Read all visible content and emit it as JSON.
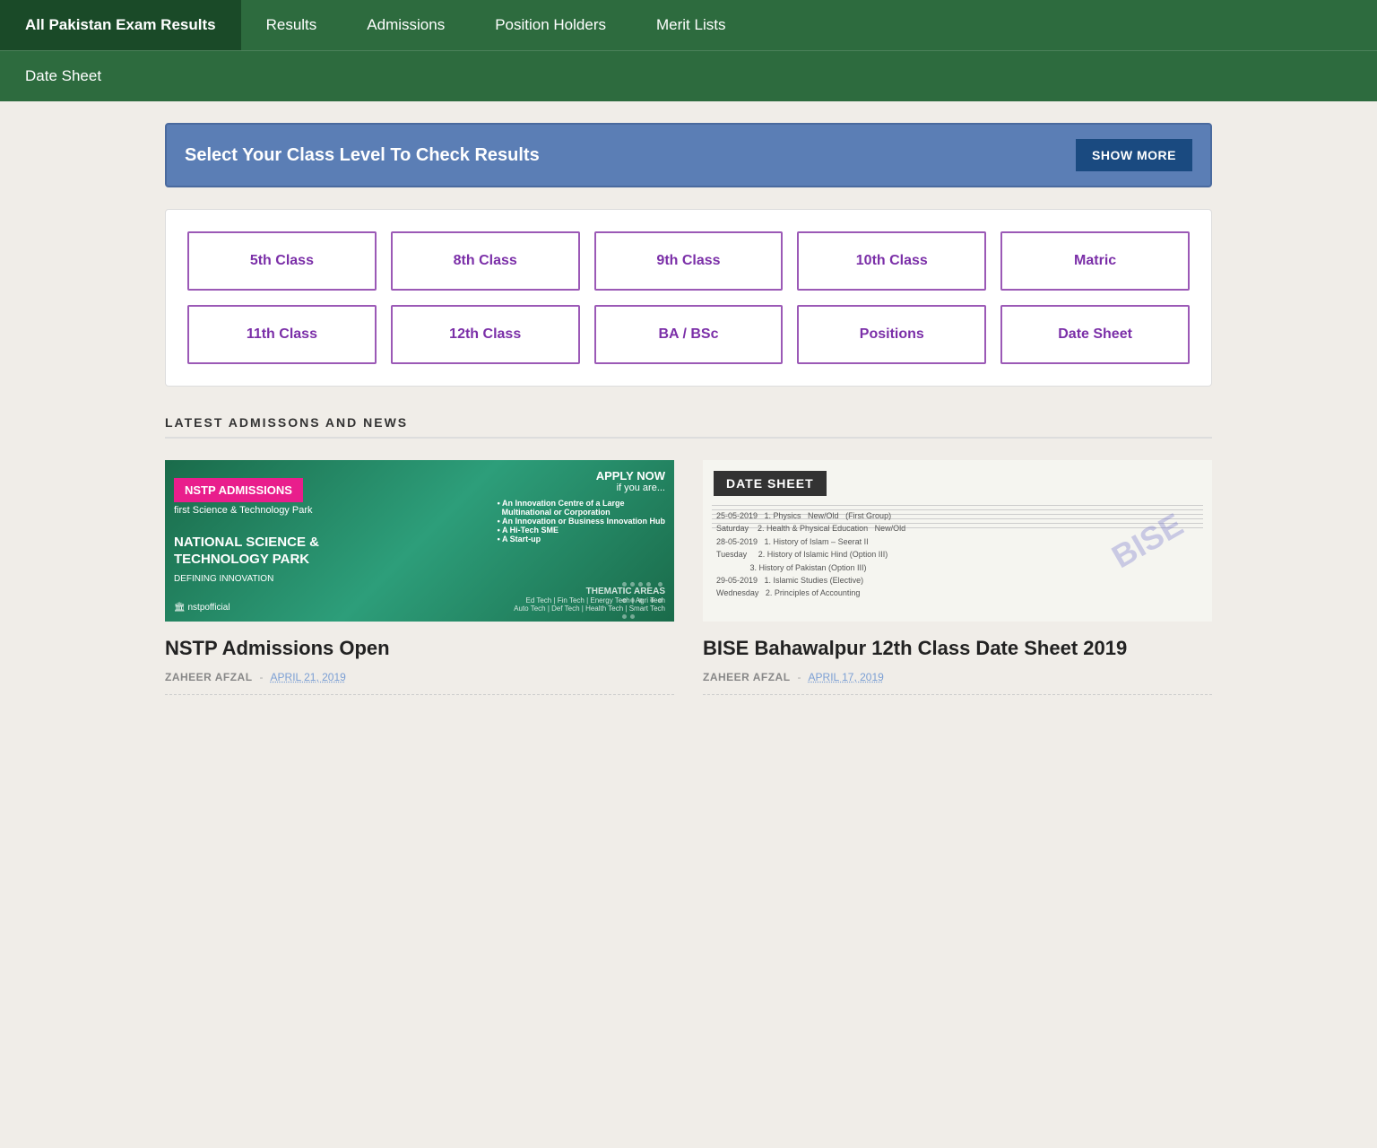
{
  "nav": {
    "brand": "All Pakistan Exam Results",
    "items_row1": [
      {
        "label": "All Pakistan Exam Results",
        "active": true,
        "id": "brand"
      },
      {
        "label": "Results",
        "active": false,
        "id": "results"
      },
      {
        "label": "Admissions",
        "active": false,
        "id": "admissions"
      },
      {
        "label": "Position Holders",
        "active": false,
        "id": "position-holders"
      },
      {
        "label": "Merit Lists",
        "active": false,
        "id": "merit-lists"
      }
    ],
    "items_row2": [
      {
        "label": "Date Sheet",
        "active": false,
        "id": "date-sheet"
      }
    ]
  },
  "class_selector": {
    "title": "Select Your Class Level To Check Results",
    "show_more_label": "SHOW MORE",
    "classes": [
      {
        "label": "5th Class",
        "id": "5th"
      },
      {
        "label": "8th Class",
        "id": "8th"
      },
      {
        "label": "9th Class",
        "id": "9th"
      },
      {
        "label": "10th Class",
        "id": "10th"
      },
      {
        "label": "Matric",
        "id": "matric"
      },
      {
        "label": "11th Class",
        "id": "11th"
      },
      {
        "label": "12th Class",
        "id": "12th"
      },
      {
        "label": "BA / BSc",
        "id": "ba-bsc"
      },
      {
        "label": "Positions",
        "id": "positions"
      },
      {
        "label": "Date Sheet",
        "id": "date-sheet-btn"
      }
    ]
  },
  "latest_news": {
    "section_title": "LATEST ADMISSONS AND NEWS",
    "articles": [
      {
        "id": "nstp",
        "title": "NSTP Admissions Open",
        "author": "ZAHEER AFZAL",
        "date": "APRIL 21, 2019",
        "image_type": "nstp",
        "nstp_label": "NSTP ADMISSIONS",
        "nstp_sublabel": "first Science & Technology Park",
        "nstp_main": "NATIONAL SCIENCE &\nTECHNOLOGY PARK",
        "nstp_tagline": "DEFINING INNOVATION",
        "nstp_apply": "APPLY NOW",
        "nstp_apply_sub": "if you are...",
        "nstp_areas_title": "THEMATIC AREAS",
        "nstp_areas": "Ed Tech | Fin Tech | Energy Tech | Agri Tech\nAuto Tech | Def Tech | Health Tech | Smart Tech"
      },
      {
        "id": "bise-bahawalpur",
        "title": "BISE Bahawalpur 12th Class Date Sheet 2019",
        "author": "ZAHEER AFZAL",
        "date": "APRIL 17, 2019",
        "image_type": "datesheet",
        "datesheet_badge": "DATE SHEET"
      }
    ]
  }
}
